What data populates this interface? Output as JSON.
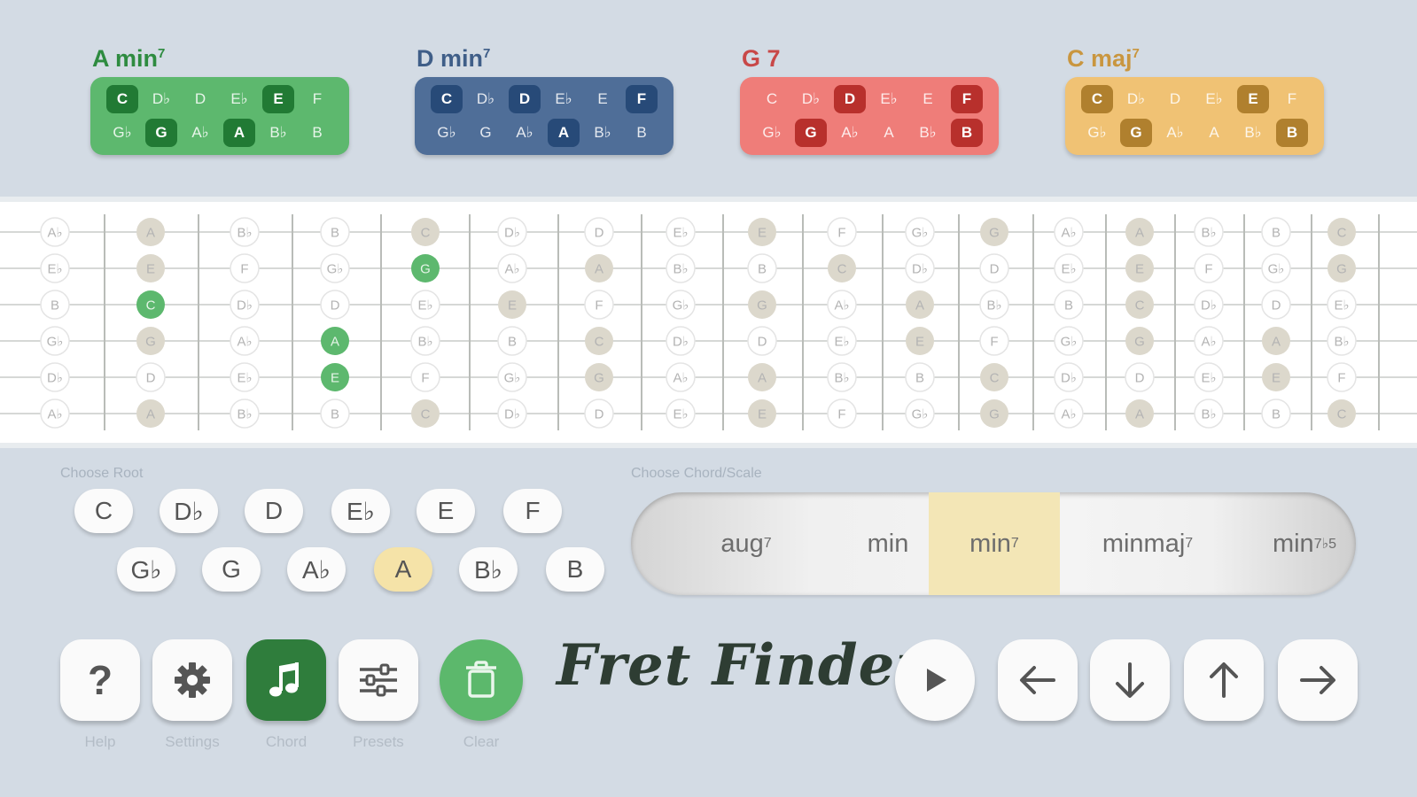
{
  "chords": [
    {
      "name": "A min",
      "sup": "7",
      "color": "#5db86e",
      "title_color": "#2e8b40",
      "on_color": "#217a34",
      "row1": [
        "C",
        "D♭",
        "D",
        "E♭",
        "E",
        "F"
      ],
      "row1_on": [
        true,
        false,
        false,
        false,
        true,
        false
      ],
      "row2": [
        "G♭",
        "G",
        "A♭",
        "A",
        "B♭",
        "B"
      ],
      "row2_on": [
        false,
        true,
        false,
        true,
        false,
        false
      ]
    },
    {
      "name": "D min",
      "sup": "7",
      "color": "#4f6e98",
      "title_color": "#3f5e88",
      "on_color": "#274a78",
      "row1": [
        "C",
        "D♭",
        "D",
        "E♭",
        "E",
        "F"
      ],
      "row1_on": [
        true,
        false,
        true,
        false,
        false,
        true
      ],
      "row2": [
        "G♭",
        "G",
        "A♭",
        "A",
        "B♭",
        "B"
      ],
      "row2_on": [
        false,
        false,
        false,
        true,
        false,
        false
      ]
    },
    {
      "name": "G 7",
      "sup": "",
      "color": "#ef7d79",
      "title_color": "#c84848",
      "on_color": "#b8302c",
      "row1": [
        "C",
        "D♭",
        "D",
        "E♭",
        "E",
        "F"
      ],
      "row1_on": [
        false,
        false,
        true,
        false,
        false,
        true
      ],
      "row2": [
        "G♭",
        "G",
        "A♭",
        "A",
        "B♭",
        "B"
      ],
      "row2_on": [
        false,
        true,
        false,
        false,
        false,
        true
      ]
    },
    {
      "name": "C maj",
      "sup": "7",
      "color": "#f0c274",
      "title_color": "#c9963f",
      "on_color": "#b0802e",
      "row1": [
        "C",
        "D♭",
        "D",
        "E♭",
        "E",
        "F"
      ],
      "row1_on": [
        true,
        false,
        false,
        false,
        true,
        false
      ],
      "row2": [
        "G♭",
        "G",
        "A♭",
        "A",
        "B♭",
        "B"
      ],
      "row2_on": [
        false,
        true,
        false,
        false,
        false,
        true
      ]
    }
  ],
  "fretboard": {
    "strings": [
      [
        "A♭",
        "A",
        "B♭",
        "B",
        "C",
        "D♭",
        "D",
        "E♭",
        "E",
        "F",
        "G♭",
        "G",
        "A♭",
        "A",
        "B♭",
        "B",
        "C"
      ],
      [
        "E♭",
        "E",
        "F",
        "G♭",
        "G",
        "A♭",
        "A",
        "B♭",
        "B",
        "C",
        "D♭",
        "D",
        "E♭",
        "E",
        "F",
        "G♭",
        "G"
      ],
      [
        "B",
        "C",
        "D♭",
        "D",
        "E♭",
        "E",
        "F",
        "G♭",
        "G",
        "A♭",
        "A",
        "B♭",
        "B",
        "C",
        "D♭",
        "D",
        "E♭"
      ],
      [
        "G♭",
        "G",
        "A♭",
        "A",
        "B♭",
        "B",
        "C",
        "D♭",
        "D",
        "E♭",
        "E",
        "F",
        "G♭",
        "G",
        "A♭",
        "A",
        "B♭"
      ],
      [
        "D♭",
        "D",
        "E♭",
        "E",
        "F",
        "G♭",
        "G",
        "A♭",
        "A",
        "B♭",
        "B",
        "C",
        "D♭",
        "D",
        "E♭",
        "E",
        "F"
      ],
      [
        "A♭",
        "A",
        "B♭",
        "B",
        "C",
        "D♭",
        "D",
        "E♭",
        "E",
        "F",
        "G♭",
        "G",
        "A♭",
        "A",
        "B♭",
        "B",
        "C"
      ]
    ],
    "chord_tones": [
      "A",
      "C",
      "E",
      "G"
    ],
    "highlighted": [
      [
        1,
        4
      ],
      [
        2,
        1
      ],
      [
        3,
        3
      ],
      [
        4,
        3
      ]
    ],
    "tone_color": "#dcd8cc",
    "highlight_color": "#5db86e"
  },
  "root": {
    "label": "Choose Root",
    "row1": [
      "C",
      "D♭",
      "D",
      "E♭",
      "E",
      "F"
    ],
    "row2": [
      "G♭",
      "G",
      "A♭",
      "A",
      "B♭",
      "B"
    ],
    "selected": "A"
  },
  "chord_scale": {
    "label": "Choose Chord/Scale",
    "items": [
      {
        "text": "aug",
        "sup": "7"
      },
      {
        "text": "min",
        "sup": ""
      },
      {
        "text": "min",
        "sup": "7"
      },
      {
        "text": "minmaj",
        "sup": "7"
      },
      {
        "text": "min",
        "sup": "7♭5"
      }
    ],
    "selected_index": 2
  },
  "toolbar": {
    "help_label": "Help",
    "settings_label": "Settings",
    "chord_label": "Chord",
    "presets_label": "Presets",
    "clear_label": "Clear",
    "help_glyph": "?"
  },
  "logo_text": "Fret Finder",
  "icons": [
    "question-icon",
    "gear-icon",
    "music-note-icon",
    "sliders-icon",
    "trash-icon",
    "play-icon",
    "arrow-left-icon",
    "arrow-down-icon",
    "arrow-up-icon",
    "arrow-right-icon"
  ]
}
